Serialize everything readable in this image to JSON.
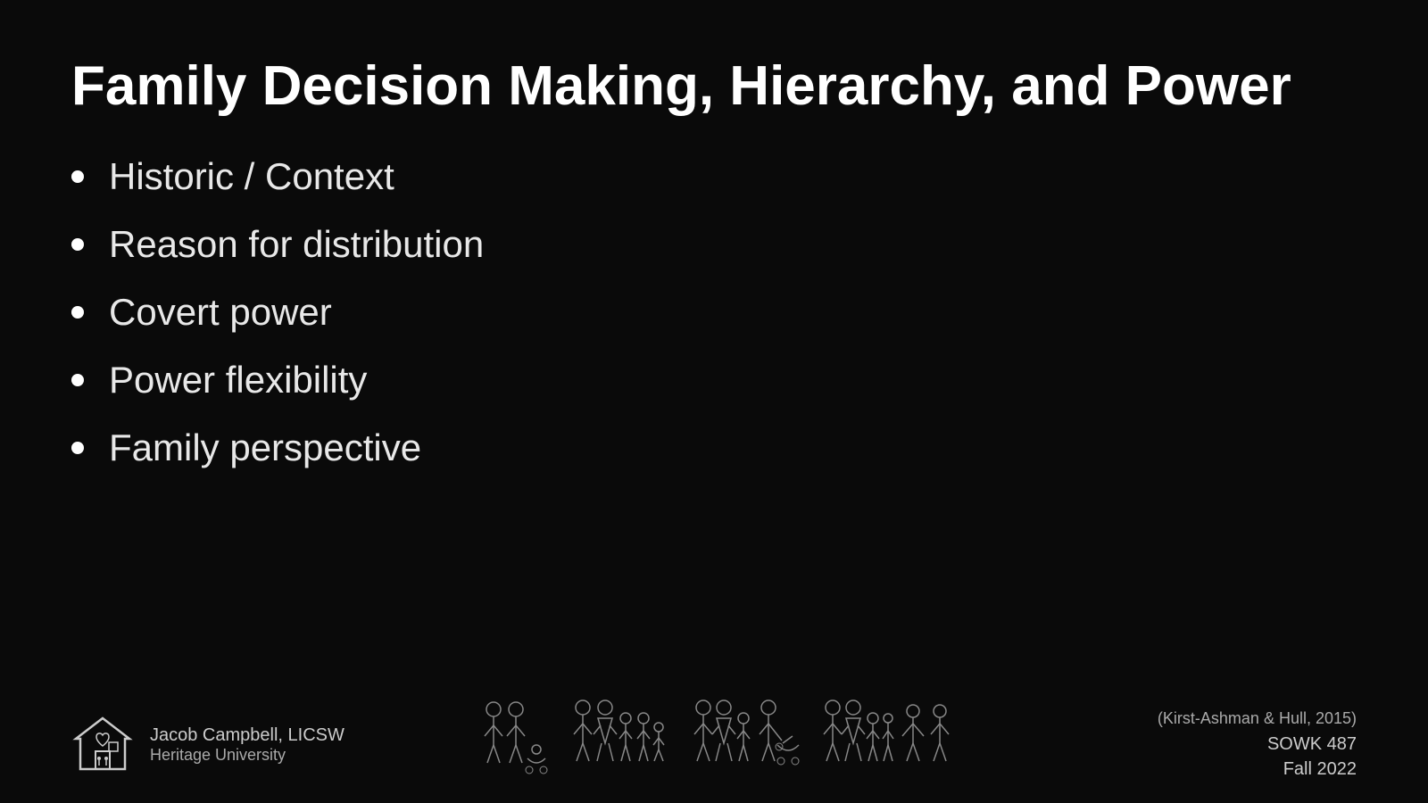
{
  "slide": {
    "title": "Family Decision Making, Hierarchy, and Power",
    "bullets": [
      "Historic / Context",
      "Reason for distribution",
      "Covert power",
      "Power flexibility",
      "Family perspective"
    ]
  },
  "footer": {
    "author_name": "Jacob Campbell, LICSW",
    "university": "Heritage University",
    "citation": "(Kirst-Ashman & Hull, 2015)",
    "course": "SOWK 487",
    "term": "Fall 2022"
  }
}
